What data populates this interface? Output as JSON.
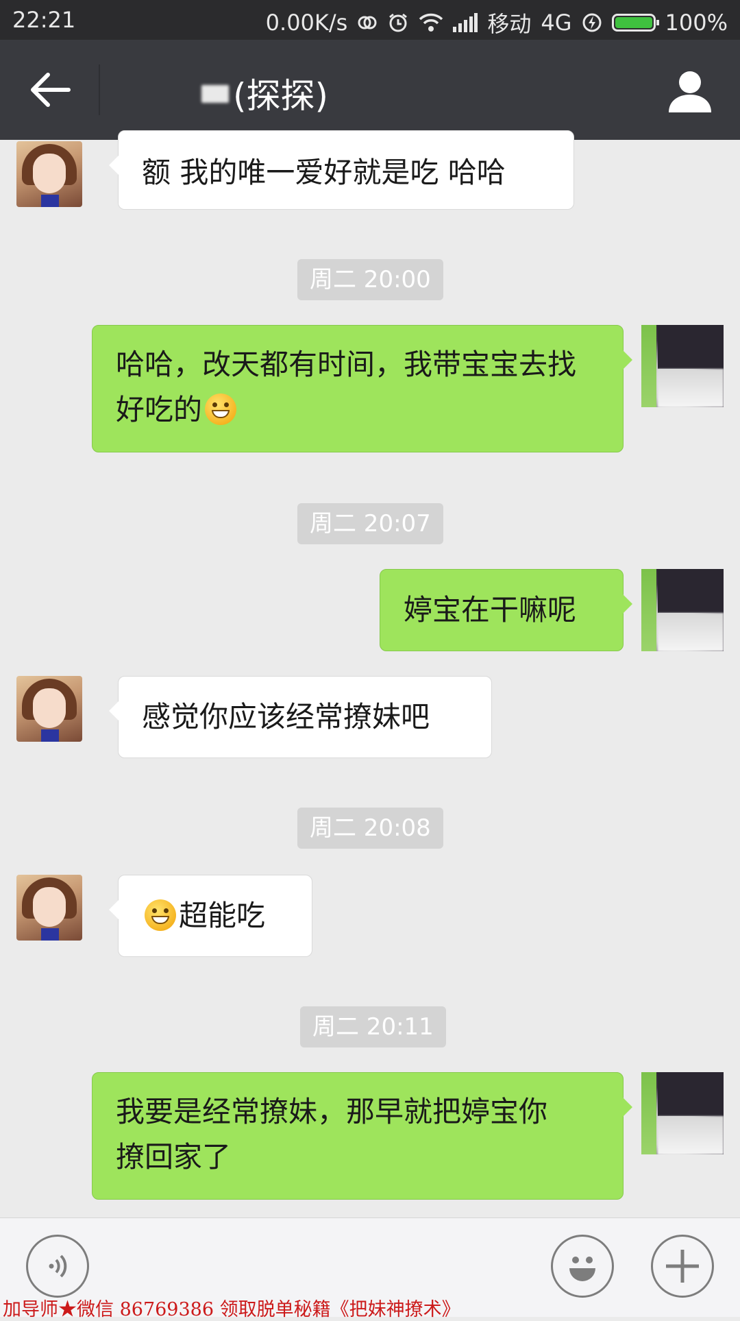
{
  "status_bar": {
    "time": "22:21",
    "network_speed": "0.00K/s",
    "carrier": "移动",
    "network_type": "4G",
    "battery": "100%",
    "icons": [
      "sync-icon",
      "alarm-icon",
      "wifi-icon",
      "signal-icon",
      "charging-icon",
      "battery-icon"
    ]
  },
  "nav": {
    "title_suffix": "(探探)",
    "back_icon": "arrow-left-icon",
    "profile_icon": "person-icon"
  },
  "messages": [
    {
      "type": "received",
      "text": "额 我的唯一爱好就是吃 哈哈"
    },
    {
      "type": "time",
      "text": "周二 20:00"
    },
    {
      "type": "sent",
      "line1": "哈哈，改天都有时间，我带宝宝去找",
      "line2": "好吃的",
      "emoji": "grin-emoji"
    },
    {
      "type": "time",
      "text": "周二 20:07"
    },
    {
      "type": "sent",
      "text": "婷宝在干嘛呢"
    },
    {
      "type": "received",
      "text": "感觉你应该经常撩妹吧"
    },
    {
      "type": "time",
      "text": "周二 20:08"
    },
    {
      "type": "received",
      "text": "超能吃",
      "emoji": "grin-emoji"
    },
    {
      "type": "time",
      "text": "周二 20:11"
    },
    {
      "type": "sent",
      "line1": "我要是经常撩妹，那早就把婷宝你",
      "line2": "撩回家了"
    }
  ],
  "input_bar": {
    "voice_icon": "voice-icon",
    "emoji_icon": "smiley-icon",
    "plus_icon": "plus-icon"
  },
  "watermark": "加导师★微信 86769386 领取脱单秘籍《把妹神撩术》",
  "colors": {
    "sent_bubble": "#9ee45c",
    "received_bubble": "#ffffff",
    "nav_bg": "#393a3f",
    "chat_bg": "#ebebeb",
    "watermark": "#cc1a1a"
  }
}
